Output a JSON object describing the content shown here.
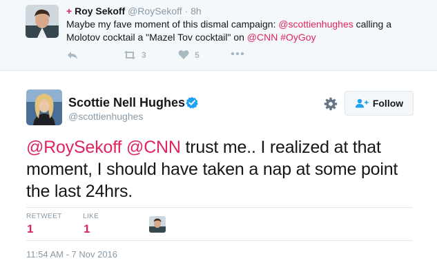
{
  "colors": {
    "accent": "#e0245e",
    "verified": "#1da1f2",
    "muted": "#8899a6",
    "icon_muted": "#aab8c2",
    "parent_background": "#f5f8fa",
    "divider": "#e1e8ed"
  },
  "parent_tweet": {
    "context_marker": "+",
    "author_name": "Roy Sekoff",
    "author_handle": "@RoySekoff",
    "separator": " · ",
    "time": "8h",
    "text_parts": [
      "Maybe my fave moment of this dismal campaign: ",
      "@scottienhughes",
      " calling a Molotov cocktail a \"Mazel Tov cocktail\" on ",
      "@CNN",
      " ",
      "#OyGoy"
    ],
    "actions": {
      "reply_icon": "reply-icon",
      "retweet_icon": "retweet-icon",
      "retweet_count": "3",
      "like_icon": "heart-icon",
      "like_count": "5",
      "more_icon": "more-dots-icon"
    }
  },
  "main_tweet": {
    "author_name": "Scottie Nell Hughes",
    "verified_icon": "verified-badge-icon",
    "author_handle": "@scottienhughes",
    "settings_icon": "gear-icon",
    "follow_label": "Follow",
    "follow_icon": "follow-person-plus-icon",
    "text_parts": [
      "@RoySekoff",
      " ",
      "@CNN",
      " trust me.. I realized at that moment, I should have taken a nap at some point the last 24hrs."
    ],
    "stats": {
      "retweets_label": "RETWEET",
      "retweets_value": "1",
      "likes_label": "LIKE",
      "likes_value": "1"
    },
    "timestamp": "11:54 AM - 7 Nov 2016"
  }
}
